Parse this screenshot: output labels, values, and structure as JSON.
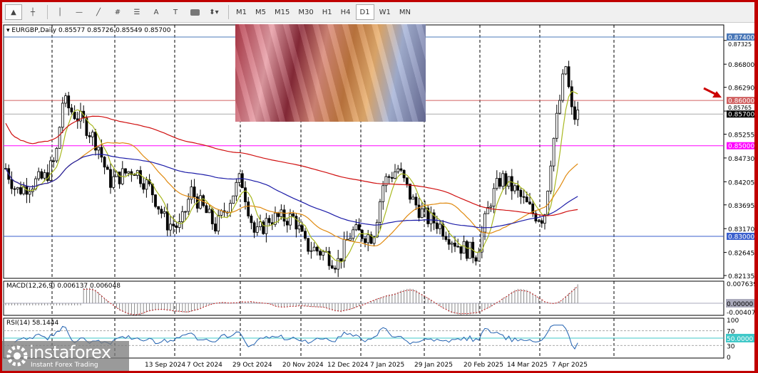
{
  "toolbar": {
    "tools": [
      "cursor-icon",
      "crosshair-icon",
      "vertical-line-icon",
      "horizontal-line-icon",
      "trendline-icon",
      "fibonacci-icon",
      "fibo-levels-icon",
      "text-icon",
      "text-label-icon",
      "rectangle-icon",
      "arrows-icon"
    ],
    "text_tool_label": "A",
    "timeframes": [
      "M1",
      "M5",
      "M15",
      "M30",
      "H1",
      "H4",
      "D1",
      "W1",
      "MN"
    ],
    "active_timeframe": "D1"
  },
  "legend": {
    "symbol": "EURGBP,Daily",
    "ohlc": "0.85577 0.85726 0.85549 0.85700"
  },
  "price_axis": {
    "ticks": [
      "0.87325",
      "0.86800",
      "0.86290",
      "0.85765",
      "0.85255",
      "0.84730",
      "0.84205",
      "0.83695",
      "0.83170",
      "0.82645",
      "0.82135"
    ],
    "levels": [
      {
        "value": "0.87400",
        "color": "#4a78b8"
      },
      {
        "value": "0.86000",
        "color": "#d06060"
      },
      {
        "value": "0.85700",
        "color": "#000000"
      },
      {
        "value": "0.85000",
        "color": "#ff00ff"
      },
      {
        "value": "0.83000",
        "color": "#3a5fcd"
      }
    ]
  },
  "date_axis": [
    "13 Sep 2024",
    "7 Oct 2024",
    "29 Oct 2024",
    "20 Nov 2024",
    "12 Dec 2024",
    "7 Jan 2025",
    "29 Jan 2025",
    "20 Feb 2025",
    "14 Mar 2025",
    "7 Apr 2025"
  ],
  "macd": {
    "label": "MACD(12,26,9) 0.006137 0.006048",
    "ticks": [
      "0.007639",
      "0.00000",
      "-0.00407"
    ]
  },
  "rsi": {
    "label": "RSI(14) 58.1444",
    "ticks": [
      "100",
      "70",
      "50.0000",
      "30",
      "0"
    ]
  },
  "logo": {
    "name": "instaforex",
    "tagline": "Instant Forex Trading"
  },
  "chart_data": {
    "type": "candlestick",
    "symbol": "EURGBP",
    "timeframe": "Daily",
    "ylim": [
      0.8205,
      0.8775
    ],
    "approx_close_path": [
      0.845,
      0.84,
      0.843,
      0.847,
      0.86,
      0.858,
      0.855,
      0.85,
      0.842,
      0.845,
      0.84,
      0.833,
      0.832,
      0.84,
      0.832,
      0.843,
      0.83,
      0.834,
      0.834,
      0.828,
      0.826,
      0.824,
      0.831,
      0.83,
      0.842,
      0.845,
      0.838,
      0.834,
      0.833,
      0.828,
      0.826,
      0.838,
      0.843,
      0.84,
      0.835,
      0.834,
      0.848,
      0.858,
      0.868,
      0.856,
      0.857
    ]
  }
}
